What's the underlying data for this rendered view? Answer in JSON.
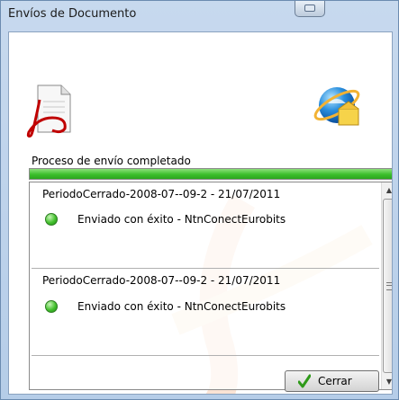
{
  "window": {
    "title": "Envíos de Documento"
  },
  "status_text": "Proceso de envío completado",
  "progress": {
    "percent": 100,
    "color": "#3cbf2c"
  },
  "log": {
    "entries": [
      {
        "title": "PeriodoCerrado-2008-07--09-2 - 21/07/2011",
        "status": "Enviado con éxito - NtnConectEurobits",
        "status_icon": "green-check-dot"
      },
      {
        "title": "PeriodoCerrado-2008-07--09-2 - 21/07/2011",
        "status": "Enviado con éxito - NtnConectEurobits",
        "status_icon": "green-check-dot"
      }
    ]
  },
  "buttons": {
    "close_label": "Cerrar"
  },
  "icons": {
    "document": "pdf-document-icon",
    "transfer": "internet-explorer-icon"
  }
}
